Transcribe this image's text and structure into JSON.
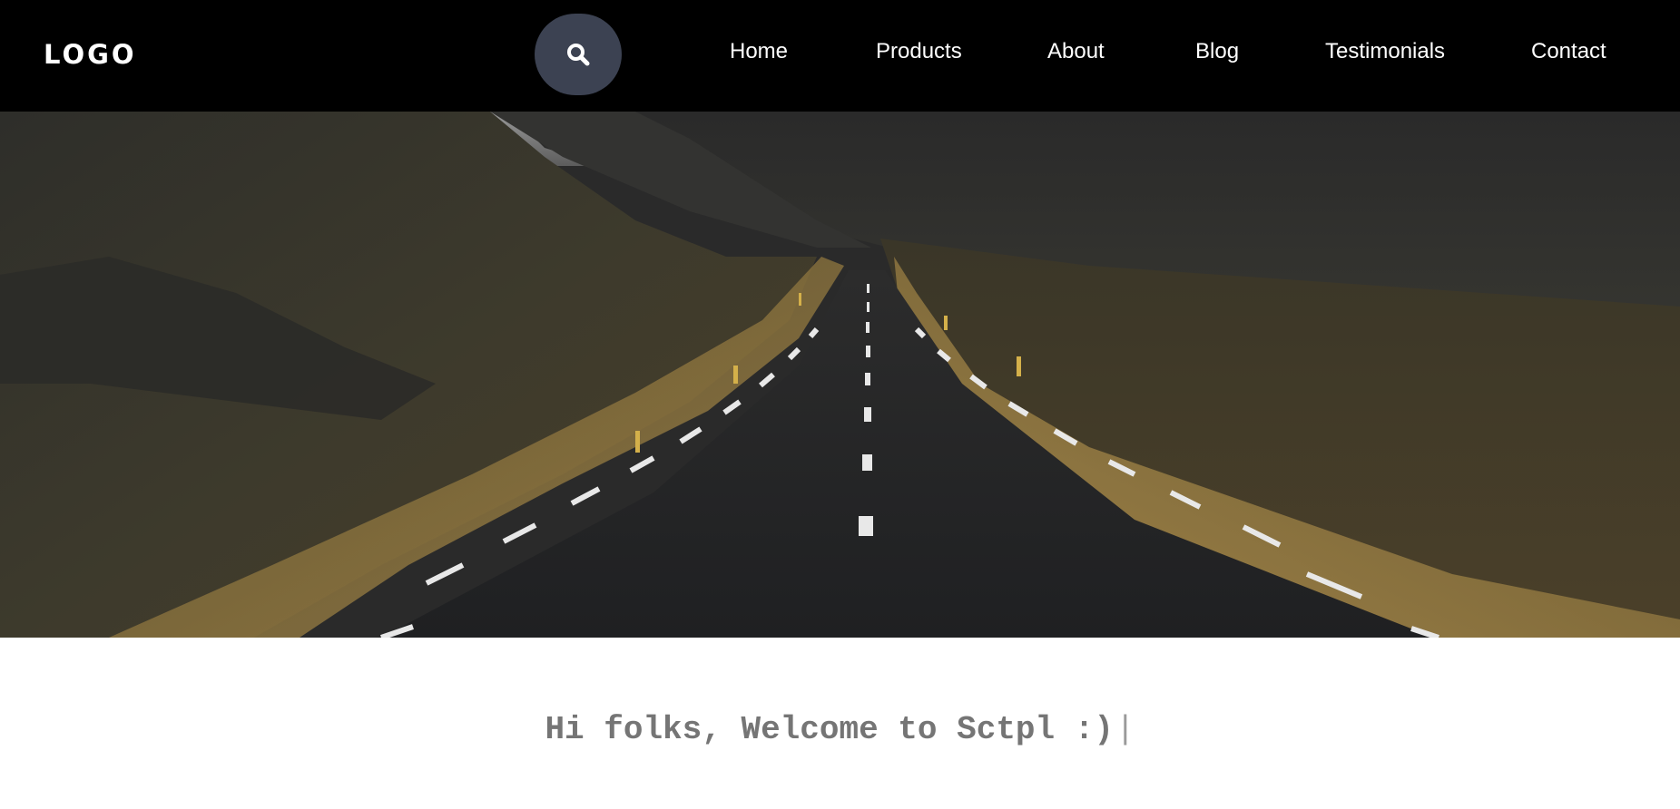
{
  "header": {
    "logo": "LOGO",
    "search_icon": "search-icon",
    "nav": [
      {
        "label": "Home"
      },
      {
        "label": "Products"
      },
      {
        "label": "About"
      },
      {
        "label": "Blog"
      },
      {
        "label": "Testimonials"
      },
      {
        "label": "Contact"
      }
    ]
  },
  "hero": {
    "image": "mountain-road-photo"
  },
  "welcome": {
    "text": "Hi folks, Welcome to Sctpl :)",
    "cursor": "|"
  },
  "colors": {
    "nav_background": "#000000",
    "search_button": "#3c4252",
    "welcome_text": "#757575"
  }
}
